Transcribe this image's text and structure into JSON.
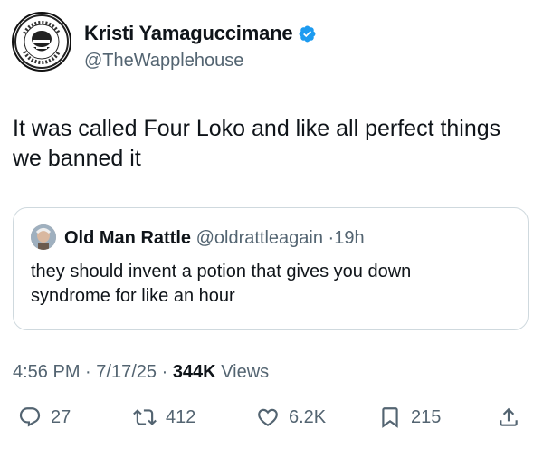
{
  "author": {
    "display_name": "Kristi Yamaguccimane",
    "handle": "@TheWapplehouse",
    "verified": true
  },
  "tweet": {
    "lines": [
      "It was called Four Loko and like all perfect things",
      "we banned it"
    ]
  },
  "quote": {
    "display_name": "Old Man Rattle",
    "handle": "@oldrattleagain",
    "separator": "·",
    "time": "19h",
    "lines": [
      "they should invent a potion that gives you down",
      "syndrome for like an hour"
    ]
  },
  "meta": {
    "time": "4:56 PM",
    "sep1": "·",
    "date": "7/17/25",
    "sep2": "·",
    "views_count": "344K",
    "views_label": "Views"
  },
  "actions": {
    "replies": "27",
    "reposts": "412",
    "likes": "6.2K",
    "bookmarks": "215"
  },
  "colors": {
    "secondary_text": "#536471",
    "primary_text": "#0f1419",
    "verified_blue": "#1d9bf0",
    "border": "#cfd9de"
  },
  "icons": [
    "reply-icon",
    "repost-icon",
    "like-icon",
    "bookmark-icon",
    "share-icon",
    "verified-badge-icon"
  ]
}
